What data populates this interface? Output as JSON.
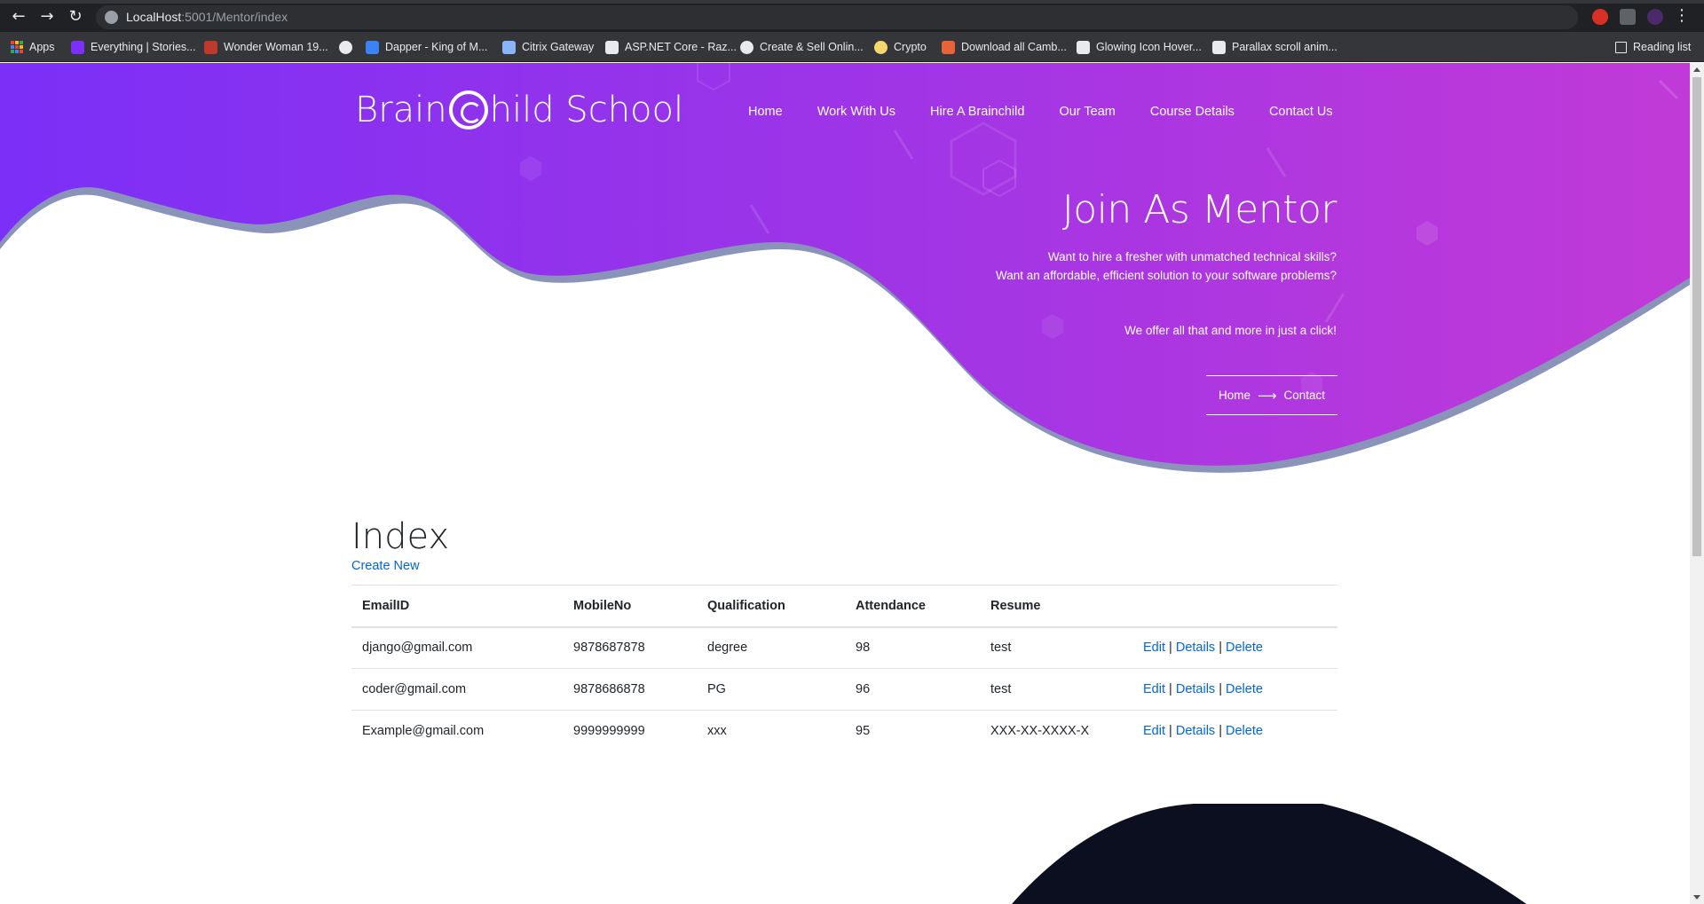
{
  "browser": {
    "url_host": "LocalHost",
    "url_path": ":5001/Mentor/index",
    "bookmarks": [
      {
        "label": "Apps",
        "icon": "apps-grid-icon",
        "color": "#4285f4"
      },
      {
        "label": "Everything | Stories...",
        "icon": "stories-favicon",
        "color": "#7b2ff7"
      },
      {
        "label": "Wonder Woman 19...",
        "icon": "wonder-woman-favicon",
        "color": "#c0392b"
      },
      {
        "label": "",
        "icon": "globe-favicon",
        "color": "#e8eaed"
      },
      {
        "label": "Dapper - King of M...",
        "icon": "dapper-favicon",
        "color": "#3b82f6"
      },
      {
        "label": "Citrix Gateway",
        "icon": "lock-favicon",
        "color": "#8ab4f8"
      },
      {
        "label": "ASP.NET Core - Raz...",
        "icon": "asp-favicon",
        "color": "#e8eaed"
      },
      {
        "label": "Create & Sell Onlin...",
        "icon": "globe-favicon",
        "color": "#e8eaed"
      },
      {
        "label": "Crypto",
        "icon": "crypto-favicon",
        "color": "#f5d76e"
      },
      {
        "label": "Download all Camb...",
        "icon": "download-favicon",
        "color": "#e8623a"
      },
      {
        "label": "Glowing Icon Hover...",
        "icon": "codepen-favicon",
        "color": "#e8eaed"
      },
      {
        "label": "Parallax scroll anim...",
        "icon": "codepen-favicon",
        "color": "#e8eaed"
      }
    ],
    "reading_list": "Reading list"
  },
  "site": {
    "logo_part1": "Brain",
    "logo_part2": "hild School",
    "nav": [
      "Home",
      "Work With Us",
      "Hire A Brainchild",
      "Our Team",
      "Course Details",
      "Contact Us"
    ]
  },
  "hero": {
    "title": "Join As Mentor",
    "line1": "Want to hire a fresher with unmatched technical skills?",
    "line2": "Want an affordable, efficient solution to your software problems?",
    "line3": "We offer all that and more in just a click!",
    "crumb_home": "Home",
    "crumb_current": "Contact",
    "gradient_start": "#7b2ff7",
    "gradient_end": "#c13ad7"
  },
  "index": {
    "title": "Index",
    "create_new": "Create New",
    "columns": [
      "EmailID",
      "MobileNo",
      "Qualification",
      "Attendance",
      "Resume"
    ],
    "actions": {
      "edit": "Edit",
      "details": "Details",
      "delete": "Delete",
      "sep": "|"
    },
    "rows": [
      {
        "email": "django@gmail.com",
        "mobile": "9878687878",
        "qualification": "degree",
        "attendance": "98",
        "resume": "test"
      },
      {
        "email": "coder@gmail.com",
        "mobile": "9878686878",
        "qualification": "PG",
        "attendance": "96",
        "resume": "test"
      },
      {
        "email": "Example@gmail.com",
        "mobile": "9999999999",
        "qualification": "xxx",
        "attendance": "95",
        "resume": "XXX-XX-XXXX-X"
      }
    ]
  }
}
